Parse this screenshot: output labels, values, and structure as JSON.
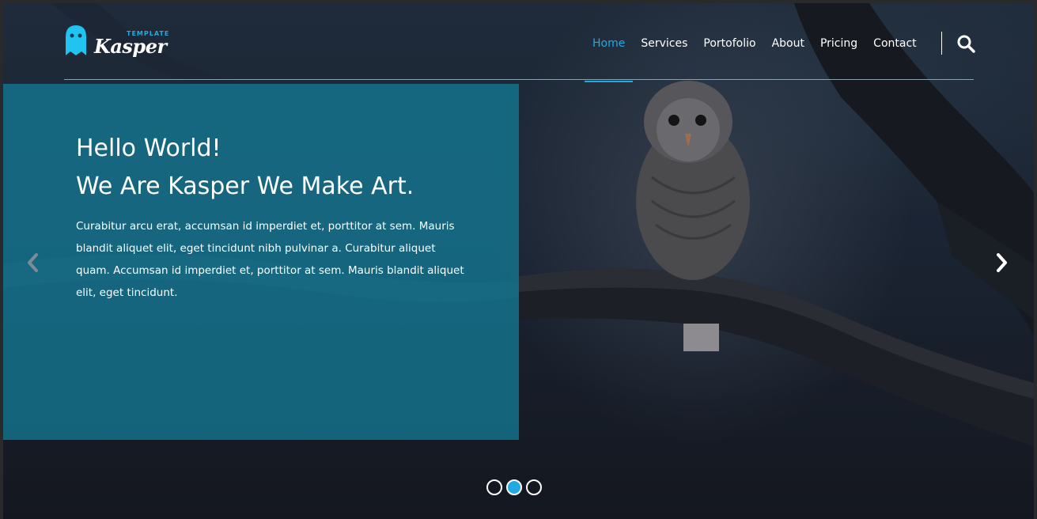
{
  "brand": {
    "tagline": "TEMPLATE",
    "name": "Kasper",
    "accent_color": "#21a9e1"
  },
  "nav": {
    "items": [
      {
        "label": "Home",
        "active": true
      },
      {
        "label": "Services",
        "active": false
      },
      {
        "label": "Portofolio",
        "active": false
      },
      {
        "label": "About",
        "active": false
      },
      {
        "label": "Pricing",
        "active": false
      },
      {
        "label": "Contact",
        "active": false
      }
    ],
    "search_icon": "search-icon"
  },
  "hero": {
    "title_line1": "Hello World!",
    "title_line2": "We Are Kasper We Make Art.",
    "paragraph": "Curabitur arcu erat, accumsan id imperdiet et, porttitor at sem. Mauris blandit aliquet elit, eget tincidunt nibh pulvinar a. Curabitur aliquet quam. Accumsan id imperdiet et, porttitor at sem. Mauris blandit aliquet elit, eget tincidunt.",
    "panel_color": "#137894",
    "background_image": "owl-on-branch"
  },
  "slider": {
    "prev_icon": "chevron-left-icon",
    "next_icon": "chevron-right-icon",
    "slide_count": 3,
    "active_slide": 2
  }
}
